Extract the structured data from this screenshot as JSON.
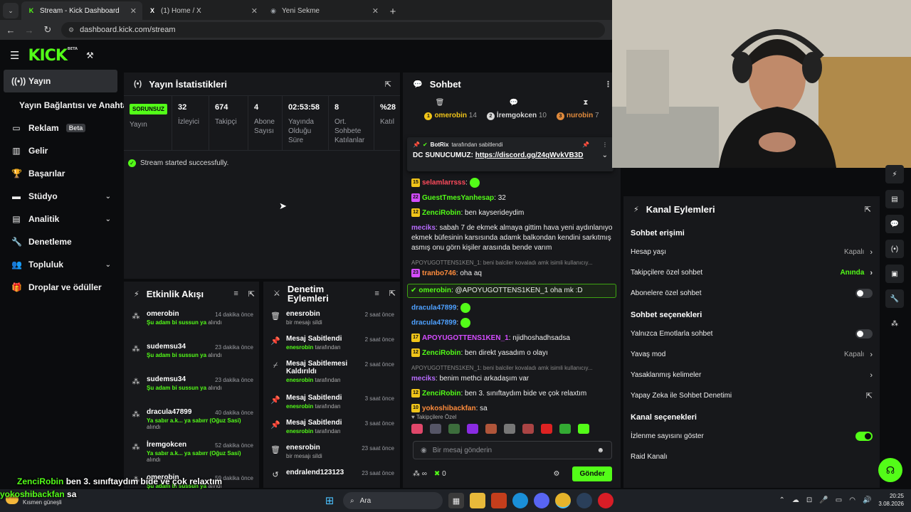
{
  "browser": {
    "tabs": [
      {
        "title": "Stream - Kick Dashboard",
        "favicon": "K",
        "favicon_color": "#53fc18",
        "active": true
      },
      {
        "title": "(1) Home / X",
        "favicon": "X",
        "favicon_color": "#ffffff",
        "active": false
      },
      {
        "title": "Yeni Sekme",
        "favicon": "◉",
        "favicon_color": "#9aa0a6",
        "active": false
      }
    ],
    "url": "dashboard.kick.com/stream"
  },
  "app": {
    "logo": "KICK",
    "logo_sup": "BETA",
    "accent": "#53fc18"
  },
  "sidebar": {
    "items": [
      {
        "label": "Yayın",
        "icon": "broadcast-icon",
        "glyph": "((•))"
      },
      {
        "label": "Yayın Bağlantısı ve Anahtarı",
        "icon": "",
        "glyph": ""
      },
      {
        "label": "Reklam",
        "icon": "tv-icon",
        "glyph": "▭",
        "badge": "Beta"
      },
      {
        "label": "Gelir",
        "icon": "revenue-icon",
        "glyph": "▥"
      },
      {
        "label": "Başarılar",
        "icon": "trophy-icon",
        "glyph": "🏆"
      },
      {
        "label": "Stüdyo",
        "icon": "studio-icon",
        "glyph": "▬"
      },
      {
        "label": "Analitik",
        "icon": "chart-icon",
        "glyph": "▤"
      },
      {
        "label": "Denetleme",
        "icon": "wrench-icon",
        "glyph": "🔧"
      },
      {
        "label": "Topluluk",
        "icon": "community-icon",
        "glyph": "👥"
      },
      {
        "label": "Droplar ve ödüller",
        "icon": "gift-icon",
        "glyph": "🎁"
      }
    ]
  },
  "stats": {
    "title": "Yayın İstatistikleri",
    "status_badge": "SORUNSUZ",
    "status_label": "Yayın",
    "cells": [
      {
        "value": "32",
        "label": "İzleyici"
      },
      {
        "value": "674",
        "label": "Takipçi"
      },
      {
        "value": "4",
        "label": "Abone Sayısı"
      },
      {
        "value": "02:53:58",
        "label": "Yayında Olduğu Süre"
      },
      {
        "value": "8",
        "label": "Ort. Sohbete Katılanlar"
      },
      {
        "value": "%28",
        "label": "Katıl"
      }
    ],
    "message": "Stream started successfully."
  },
  "activity": {
    "title": "Etkinlik Akışı",
    "items": [
      {
        "name": "omerobin",
        "time": "14 dakika önce",
        "desc": "Şu adam bi sussun ya",
        "suffix": "alındı"
      },
      {
        "name": "sudemsu34",
        "time": "23 dakika önce",
        "desc": "Şu adam bi sussun ya",
        "suffix": "alındı"
      },
      {
        "name": "sudemsu34",
        "time": "23 dakika önce",
        "desc": "Şu adam bi sussun ya",
        "suffix": "alındı"
      },
      {
        "name": "dracula47899",
        "time": "40 dakika önce",
        "desc": "Ya sabır a.k... ya sabırr (Oğuz Sasi)",
        "suffix": "alındı"
      },
      {
        "name": "İremgokcen",
        "time": "52 dakika önce",
        "desc": "Ya sabır a.k... ya sabırr (Oğuz Sasi)",
        "suffix": "alındı"
      },
      {
        "name": "omerobin",
        "time": "59 dakika önce",
        "desc": "Şu adam bi sussun ya",
        "suffix": "alındı"
      }
    ]
  },
  "modlog": {
    "title": "Denetim Eylemleri",
    "items": [
      {
        "icon": "trash-icon",
        "glyph": "🗑",
        "action": "enesrobin",
        "time": "2 saat önce",
        "sub_user": "",
        "sub": "bir mesajı sildi"
      },
      {
        "icon": "pin-icon",
        "glyph": "📌",
        "action": "Mesaj Sabitlendi",
        "time": "2 saat önce",
        "sub_user": "enesrobin",
        "sub": "tarafından"
      },
      {
        "icon": "unpin-icon",
        "glyph": "⌿",
        "action": "Mesaj Sabitlemesi Kaldırıldı",
        "time": "2 saat önce",
        "sub_user": "enesrobin",
        "sub": "tarafından"
      },
      {
        "icon": "pin-icon",
        "glyph": "📌",
        "action": "Mesaj Sabitlendi",
        "time": "3 saat önce",
        "sub_user": "enesrobin",
        "sub": "tarafından"
      },
      {
        "icon": "pin-icon",
        "glyph": "📌",
        "action": "Mesaj Sabitlendi",
        "time": "3 saat önce",
        "sub_user": "enesrobin",
        "sub": "tarafından"
      },
      {
        "icon": "trash-icon",
        "glyph": "🗑",
        "action": "enesrobin",
        "time": "23 saat önce",
        "sub_user": "",
        "sub": "bir mesajı sildi"
      },
      {
        "icon": "undo-icon",
        "glyph": "↺",
        "action": "endralend123123",
        "time": "23 saat önce",
        "sub_user": "",
        "sub": ""
      }
    ]
  },
  "chat": {
    "title": "Sohbet",
    "gifters": [
      {
        "rank": "1",
        "name": "omerobin",
        "count": "14",
        "color": "#f0c419"
      },
      {
        "rank": "2",
        "name": "İremgokcen",
        "count": "10",
        "color": "#d8d8d8"
      },
      {
        "rank": "3",
        "name": "nurobin",
        "count": "7",
        "color": "#e08a3c"
      }
    ],
    "pinned": {
      "by": "BotRix",
      "by_suffix": "tarafından sabitlendi",
      "text": "DC SUNUCUMUZ:",
      "link": "https://discord.gg/24qWvkVB3D"
    },
    "messages": [
      {
        "lvl": "15",
        "user": "selamlarrsss",
        "color": "#ff4b5c",
        "text": "",
        "emote": true
      },
      {
        "lvl": "22",
        "user": "GuestTmesYanhesap",
        "color": "#53fc18",
        "text": "32"
      },
      {
        "lvl": "12",
        "user": "ZenciRobin",
        "color": "#53fc18",
        "text": "ben kayserideydim"
      },
      {
        "lvl": "",
        "user": "meciks",
        "color": "#b86cff",
        "text": "sabah 7 de ekmek almaya gittim hava yeni aydınlanıyo ekmek büfesinin karsısında adamk balkondan kendini sarkıtmış asmış onu görn kişiler arasında bende varım"
      },
      {
        "lvl": "23",
        "user": "tranbo746",
        "color": "#ff8c3c",
        "text": "oha aq",
        "reply": "APOYUGOTTENS1KEN_1: beni balciler kovaladı amk isimli kullanıcıy..."
      },
      {
        "lvl": "",
        "user": "omerobin",
        "color": "#53fc18",
        "text": "@APOYUGOTTENS1KEN_1 oha mk :D",
        "highlight": true
      },
      {
        "lvl": "",
        "user": "dracula47899",
        "color": "#4ea0ff",
        "text": "",
        "emote": true
      },
      {
        "lvl": "",
        "user": "dracula47899",
        "color": "#4ea0ff",
        "text": "",
        "emote": true
      },
      {
        "lvl": "17",
        "user": "APOYUGOTTENS1KEN_1",
        "color": "#d44cff",
        "text": "njidhoshadhsadsa"
      },
      {
        "lvl": "12",
        "user": "ZenciRobin",
        "color": "#53fc18",
        "text": "ben direkt yasadım o olayı"
      },
      {
        "lvl": "",
        "user": "meciks",
        "color": "#b86cff",
        "text": "benim methci arkadaşım var",
        "reply": "APOYUGOTTENS1KEN_1: beni balciler kovaladı amk isimli kullanıcıy..."
      },
      {
        "lvl": "12",
        "user": "ZenciRobin",
        "color": "#53fc18",
        "text": "ben 3. sınıftaydım bide ve çok relaxtım"
      },
      {
        "lvl": "10",
        "user": "yokoshibackfan",
        "color": "#ff8c3c",
        "text": "sa"
      }
    ],
    "emote_label": "Takipçilere Özel",
    "input_placeholder": "Bir mesaj gönderin",
    "points": "∞",
    "kicks": "0",
    "send_label": "Gönder"
  },
  "actions": {
    "title": "Kanal Eylemleri",
    "sections": [
      {
        "title": "Sohbet erişimi",
        "rows": [
          {
            "label": "Hesap yaşı",
            "value": "Kapalı",
            "type": "arrow"
          },
          {
            "label": "Takipçilere özel sohbet",
            "value": "Anında",
            "type": "arrow-green"
          },
          {
            "label": "Abonelere özel sohbet",
            "value": "",
            "type": "toggle-off"
          }
        ]
      },
      {
        "title": "Sohbet seçenekleri",
        "rows": [
          {
            "label": "Yalnızca Emotlarla sohbet",
            "value": "",
            "type": "toggle-off"
          },
          {
            "label": "Yavaş mod",
            "value": "Kapalı",
            "type": "arrow"
          },
          {
            "label": "Yasaklanmış kelimeler",
            "value": "",
            "type": "arrow"
          },
          {
            "label": "Yapay Zeka ile Sohbet Denetimi",
            "value": "",
            "type": "external"
          }
        ]
      },
      {
        "title": "Kanal seçenekleri",
        "rows": [
          {
            "label": "İzlenme sayısını göster",
            "value": "",
            "type": "toggle-on"
          },
          {
            "label": "Raid Kanalı",
            "value": "",
            "type": "none"
          }
        ]
      }
    ]
  },
  "overlay": {
    "line1_user": "ZenciRobin",
    "line1_text": "ben 3. sınıftaydım bide ve çok relaxtım",
    "line2_user": "yokoshibackfan",
    "line2_text": "sa"
  },
  "taskbar": {
    "weather_temp": "27°C",
    "weather_text": "Kısmen güneşli",
    "search": "Ara",
    "time": "20:25",
    "date": "3.08.2026"
  }
}
